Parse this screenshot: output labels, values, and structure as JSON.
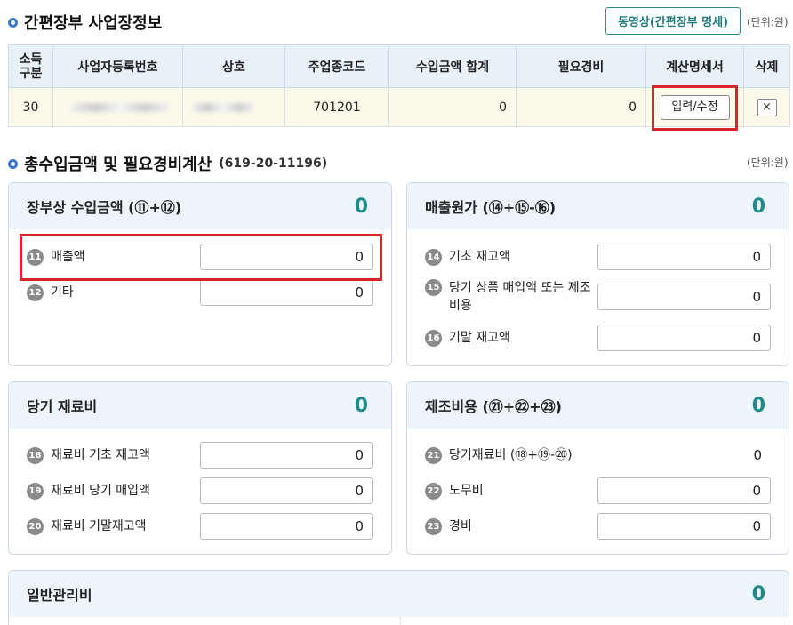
{
  "section1": {
    "title": "간편장부 사업장정보",
    "video_button": "동영상(간편장부 명세)",
    "unit": "(단위:원)"
  },
  "table": {
    "headers": [
      "소득\n구분",
      "사업자등록번호",
      "상호",
      "주업종코드",
      "수입금액 합계",
      "필요경비",
      "계산명세서",
      "삭제"
    ],
    "row": {
      "income_type": "30",
      "business_code": "701201",
      "revenue_total": "0",
      "expenses": "0",
      "edit_button": "입력/수정",
      "delete_button": "×"
    }
  },
  "section2": {
    "title": "총수입금액 및 필요경비계산",
    "reg_no": "(619-20-11196)",
    "unit": "(단위:원)"
  },
  "cards": {
    "revenue": {
      "title": "장부상 수입금액 (⑪+⑫)",
      "total": "0",
      "items": [
        {
          "num": "11",
          "label": "매출액",
          "value": "0"
        },
        {
          "num": "12",
          "label": "기타",
          "value": "0"
        }
      ]
    },
    "cogs": {
      "title": "매출원가 (⑭+⑮-⑯)",
      "total": "0",
      "items": [
        {
          "num": "14",
          "label": "기초 재고액",
          "value": "0"
        },
        {
          "num": "15",
          "label": "당기 상품 매입액 또는 제조비용",
          "value": "0"
        },
        {
          "num": "16",
          "label": "기말 재고액",
          "value": "0"
        }
      ]
    },
    "materials": {
      "title": "당기 재료비",
      "total": "0",
      "items": [
        {
          "num": "18",
          "label": "재료비 기초 재고액",
          "value": "0"
        },
        {
          "num": "19",
          "label": "재료비 당기 매입액",
          "value": "0"
        },
        {
          "num": "20",
          "label": "재료비 기말재고액",
          "value": "0"
        }
      ]
    },
    "manufacturing": {
      "title": "제조비용 (㉑+㉒+㉓)",
      "total": "0",
      "items": [
        {
          "num": "21",
          "label": "당기재료비 (⑱+⑲-⑳)",
          "value": "0"
        },
        {
          "num": "22",
          "label": "노무비",
          "value": "0"
        },
        {
          "num": "23",
          "label": "경비",
          "value": "0"
        }
      ]
    },
    "admin": {
      "title": "일반관리비",
      "total": "0"
    }
  },
  "colors": {
    "accent": "#1f8a8a",
    "header_bg": "#e8f1f9",
    "highlight": "#d9242b"
  }
}
